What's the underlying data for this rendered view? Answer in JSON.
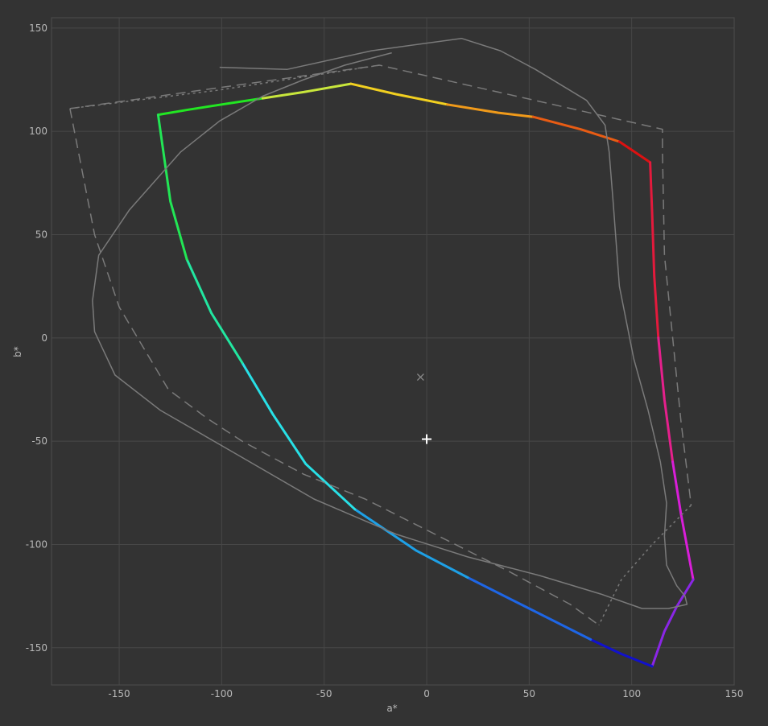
{
  "chart_data": {
    "type": "line",
    "title": "",
    "xlabel": "a*",
    "ylabel": "b*",
    "xlim": [
      -183,
      150
    ],
    "ylim": [
      -168,
      155
    ],
    "xticks": [
      -150,
      -100,
      -50,
      0,
      50,
      100,
      150
    ],
    "yticks": [
      150,
      100,
      50,
      0,
      -50,
      -100,
      -150
    ],
    "xtick_labels": [
      "-150",
      "-100",
      "-50",
      "0",
      "50",
      "100",
      "150"
    ],
    "ytick_labels": [
      "150",
      "100",
      "50",
      "0",
      "-50",
      "-100",
      "-150"
    ],
    "grid": true,
    "colors": {
      "background": "#333333",
      "frame": "#4d4d4d",
      "grid": "#474747",
      "reference": "#7a7a7a",
      "marker": "#ffffff"
    },
    "series": [
      {
        "style": "gradient-solid",
        "segments": [
          {
            "color": "#22e622",
            "points": [
              [
                -131,
                108
              ],
              [
                -116,
                110.5
              ],
              [
                -100,
                113
              ],
              [
                -80,
                116
              ]
            ]
          },
          {
            "color": "#c8e63c",
            "points": [
              [
                -80,
                116
              ],
              [
                -60,
                119
              ],
              [
                -37,
                123
              ]
            ]
          },
          {
            "color": "#f2d020",
            "points": [
              [
                -37,
                123
              ],
              [
                -15,
                118
              ],
              [
                10,
                113
              ]
            ]
          },
          {
            "color": "#f09a1a",
            "points": [
              [
                10,
                113
              ],
              [
                35,
                109
              ],
              [
                52,
                107
              ]
            ]
          },
          {
            "color": "#e85c14",
            "points": [
              [
                52,
                107
              ],
              [
                75,
                101
              ],
              [
                94,
                95
              ]
            ]
          },
          {
            "color": "#dd1111",
            "points": [
              [
                94,
                95
              ],
              [
                100,
                91
              ],
              [
                109,
                85
              ]
            ]
          },
          {
            "color": "#e31a3c",
            "points": [
              [
                109,
                85
              ],
              [
                110,
                60
              ],
              [
                111,
                30
              ],
              [
                113,
                0
              ]
            ]
          },
          {
            "color": "#e5208c",
            "points": [
              [
                113,
                0
              ],
              [
                116,
                -30
              ],
              [
                120,
                -60
              ]
            ]
          },
          {
            "color": "#d91ed9",
            "points": [
              [
                120,
                -60
              ],
              [
                124,
                -85
              ],
              [
                130,
                -117
              ]
            ]
          },
          {
            "color": "#8a26e6",
            "points": [
              [
                130,
                -117
              ],
              [
                122,
                -130
              ],
              [
                116,
                -142
              ],
              [
                110,
                -159
              ]
            ]
          },
          {
            "color": "#1111cc",
            "points": [
              [
                110,
                -159
              ],
              [
                95,
                -153
              ],
              [
                80,
                -146
              ]
            ]
          },
          {
            "color": "#1e66e6",
            "points": [
              [
                80,
                -146
              ],
              [
                50,
                -131
              ],
              [
                20,
                -116
              ]
            ]
          },
          {
            "color": "#1ea0e6",
            "points": [
              [
                20,
                -116
              ],
              [
                -5,
                -103
              ],
              [
                -35,
                -83
              ]
            ]
          },
          {
            "color": "#28e0e6",
            "points": [
              [
                -35,
                -83
              ],
              [
                -59,
                -61
              ],
              [
                -75,
                -37
              ],
              [
                -90,
                -12
              ]
            ]
          },
          {
            "color": "#22e6a0",
            "points": [
              [
                -90,
                -12
              ],
              [
                -105,
                12
              ],
              [
                -117,
                38
              ]
            ]
          },
          {
            "color": "#22e655",
            "points": [
              [
                -117,
                38
              ],
              [
                -125,
                66
              ],
              [
                -131,
                108
              ]
            ]
          }
        ]
      },
      {
        "style": "solid",
        "color": "#7a7a7a",
        "points": [
          [
            -101,
            131
          ],
          [
            -68,
            130
          ],
          [
            -27,
            139
          ],
          [
            17,
            145
          ],
          [
            36,
            139
          ],
          [
            53,
            130
          ],
          [
            78,
            115
          ],
          [
            87,
            103
          ],
          [
            89,
            90
          ],
          [
            91,
            65
          ],
          [
            94,
            25
          ],
          [
            101,
            -10
          ],
          [
            108,
            -35
          ],
          [
            114,
            -60
          ],
          [
            117,
            -80
          ],
          [
            116,
            -96
          ],
          [
            117,
            -110
          ],
          [
            122,
            -120
          ],
          [
            126,
            -125
          ],
          [
            127,
            -129
          ],
          [
            118,
            -131
          ],
          [
            105,
            -131
          ],
          [
            85,
            -124
          ],
          [
            55,
            -115
          ],
          [
            20,
            -106
          ],
          [
            -15,
            -95
          ],
          [
            -55,
            -78
          ],
          [
            -95,
            -55
          ],
          [
            -130,
            -35
          ],
          [
            -152,
            -18
          ],
          [
            -162,
            3
          ],
          [
            -163,
            18
          ],
          [
            -160,
            40
          ],
          [
            -145,
            62
          ],
          [
            -120,
            90
          ],
          [
            -101,
            105
          ],
          [
            -80,
            117
          ],
          [
            -60,
            125
          ],
          [
            -40,
            132
          ],
          [
            -17,
            138
          ]
        ]
      },
      {
        "style": "dashed",
        "color": "#7a7a7a",
        "points": [
          [
            -174,
            111
          ],
          [
            -162,
            50
          ],
          [
            -150,
            15
          ],
          [
            -126,
            -25
          ],
          [
            -107,
            -39
          ],
          [
            -90,
            -50
          ],
          [
            -60,
            -66
          ],
          [
            -30,
            -78
          ],
          [
            0,
            -93
          ],
          [
            40,
            -113
          ],
          [
            70,
            -129
          ],
          [
            84,
            -139
          ]
        ]
      },
      {
        "style": "dashed",
        "color": "#7a7a7a",
        "points": [
          [
            -174,
            111
          ],
          [
            -23,
            132
          ],
          [
            115,
            101
          ],
          [
            115,
            90
          ],
          [
            116,
            40
          ],
          [
            120,
            0
          ],
          [
            124,
            -40
          ],
          [
            129,
            -81
          ]
        ]
      },
      {
        "style": "dotted",
        "color": "#7a7a7a",
        "points": [
          [
            -174,
            111
          ],
          [
            -101,
            120
          ],
          [
            -23,
            132
          ]
        ]
      },
      {
        "style": "dotted",
        "color": "#7a7a7a",
        "points": [
          [
            129,
            -81
          ],
          [
            110,
            -100
          ],
          [
            95,
            -117
          ],
          [
            84,
            -139
          ]
        ]
      }
    ],
    "markers": [
      {
        "symbol": "×",
        "x": -3,
        "y": -19,
        "color": "#8a8a8a"
      },
      {
        "symbol": "+",
        "x": 0,
        "y": -49,
        "color": "#ffffff"
      }
    ]
  }
}
